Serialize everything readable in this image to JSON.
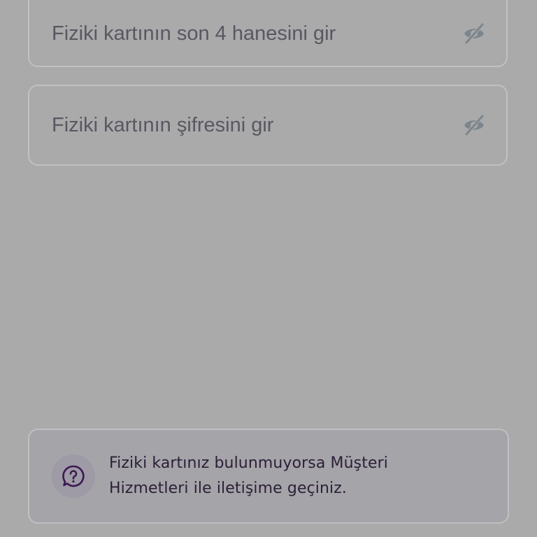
{
  "fields": {
    "last_four": {
      "placeholder": "Fiziki kartının son 4 hanesini gir",
      "toggle_icon": "eye-off-icon"
    },
    "pin": {
      "placeholder": "Fiziki kartının şifresini gir",
      "toggle_icon": "eye-off-icon"
    }
  },
  "info": {
    "icon": "help-chat-icon",
    "text": "Fiziki kartınız bulunmuyorsa Müşteri Hizmetleri ile iletişime geçiniz."
  },
  "colors": {
    "overlay_bg": "#aaaaab",
    "icon_accent": "#3b1a52",
    "eye_icon": "#7c868c"
  }
}
